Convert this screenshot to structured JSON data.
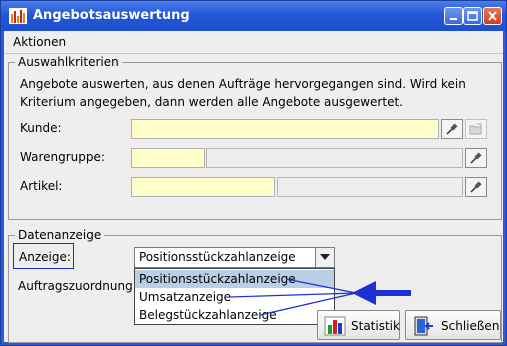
{
  "window": {
    "title": "Angebotsauswertung"
  },
  "menu": {
    "items": [
      "Aktionen"
    ]
  },
  "criteria": {
    "legend": "Auswahlkriterien",
    "description_line1": "Angebote auswerten, aus denen Aufträge hervorgegangen sind. Wird kein",
    "description_line2": "Kriterium angegeben, dann werden alle Angebote ausgewertet.",
    "kunde_label": "Kunde:",
    "warengruppe_label": "Warengruppe:",
    "artikel_label": "Artikel:",
    "kunde_value": "",
    "warengruppe_value": "",
    "artikel_value": ""
  },
  "display": {
    "legend": "Datenanzeige",
    "anzeige_label": "Anzeige:",
    "auftragszuordnung_label": "Auftragszuordnung:",
    "selected": "Positionsstückzahlanzeige",
    "options": [
      "Positionsstückzahlanzeige",
      "Umsatzanzeige",
      "Belegstückzahlanzeige"
    ]
  },
  "buttons": {
    "statistik": "Statistik",
    "schliessen": "Schließen"
  },
  "colors": {
    "titlebar": "#2357d8",
    "required_field": "#ffffcc",
    "selected_option": "#b8cfe5",
    "annotation_arrow": "#1f2fd6"
  }
}
